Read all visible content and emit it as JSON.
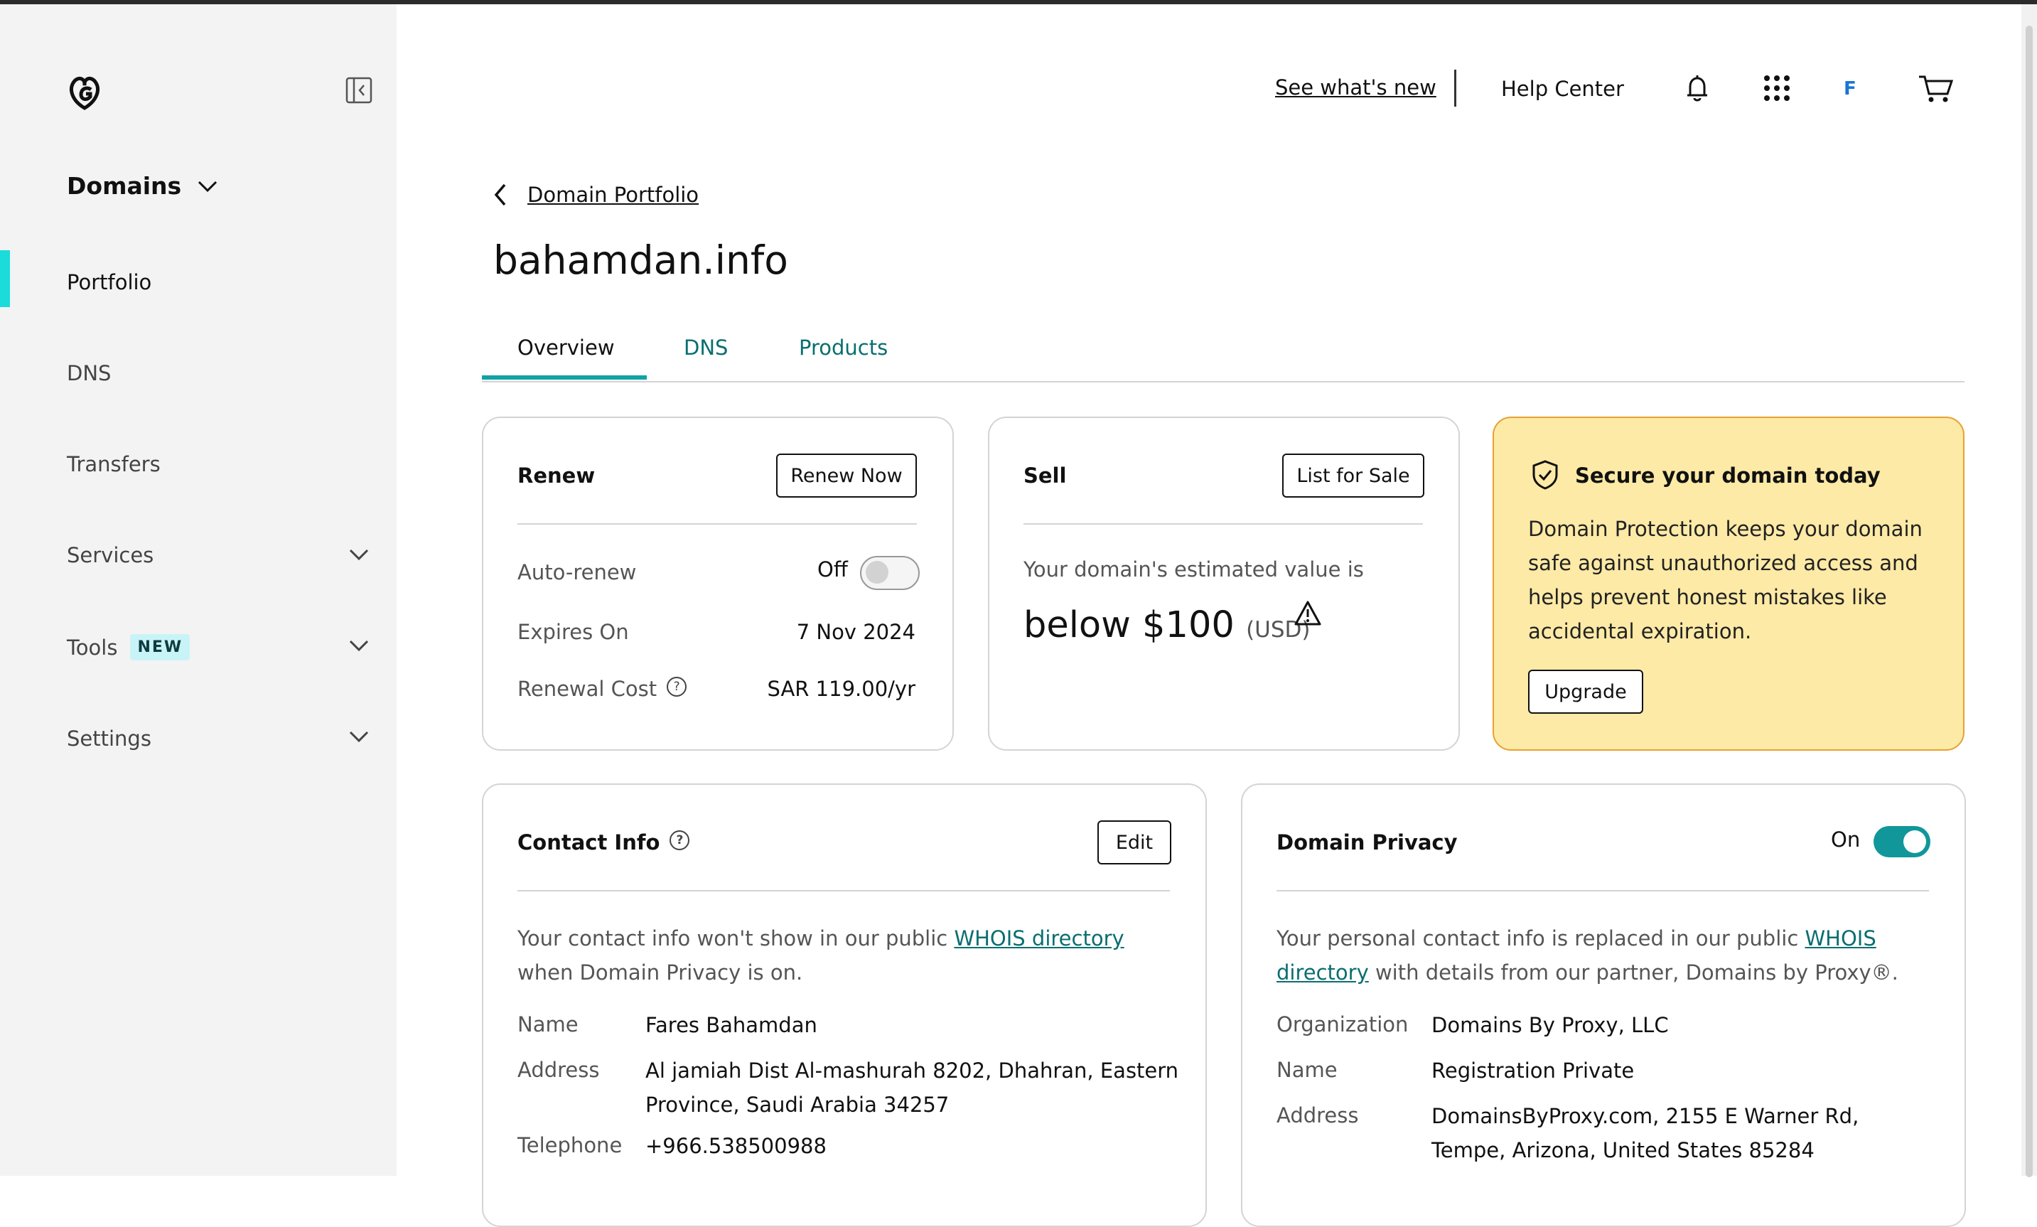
{
  "sidebar": {
    "section_title": "Domains",
    "items": [
      {
        "label": "Portfolio"
      },
      {
        "label": "DNS"
      },
      {
        "label": "Transfers"
      },
      {
        "label": "Services"
      },
      {
        "label": "Tools",
        "badge": "NEW"
      },
      {
        "label": "Settings"
      }
    ]
  },
  "header": {
    "whats_new": "See what's new",
    "help_center": "Help Center",
    "avatar_initial": "F"
  },
  "breadcrumb": {
    "back_label": "Domain Portfolio"
  },
  "page": {
    "domain": "bahamdan.info"
  },
  "tabs": [
    {
      "label": "Overview",
      "active": true
    },
    {
      "label": "DNS"
    },
    {
      "label": "Products"
    }
  ],
  "renew": {
    "title": "Renew",
    "button": "Renew Now",
    "auto_renew_label": "Auto-renew",
    "auto_renew_state": "Off",
    "expires_label": "Expires On",
    "expires_value": "7 Nov 2024",
    "cost_label": "Renewal Cost",
    "cost_value": "SAR 119.00/yr"
  },
  "sell": {
    "title": "Sell",
    "button": "List for Sale",
    "estimate_text": "Your domain's estimated value is",
    "value": "below $100",
    "currency": "(USD)"
  },
  "promo": {
    "title": "Secure your domain today",
    "body": "Domain Protection keeps your domain safe against unauthorized access and helps prevent honest mistakes like accidental expiration.",
    "button": "Upgrade"
  },
  "contact": {
    "title": "Contact Info",
    "button": "Edit",
    "desc_before": "Your contact info won't show in our public ",
    "desc_link": "WHOIS directory",
    "desc_after": " when Domain Privacy is on.",
    "name_label": "Name",
    "name_value": "Fares Bahamdan",
    "address_label": "Address",
    "address_line1": "Al jamiah Dist Al-mashurah 8202, Dhahran, Eastern",
    "address_line2": "Province, Saudi Arabia 34257",
    "phone_label": "Telephone",
    "phone_value": "+966.538500988"
  },
  "privacy": {
    "title": "Domain Privacy",
    "state": "On",
    "desc_before": "Your personal contact info is replaced in our public ",
    "desc_link1": "WHOIS",
    "desc_link2": "directory",
    "desc_after": " with details from our partner, Domains by Proxy®.",
    "org_label": "Organization",
    "org_value": "Domains By Proxy, LLC",
    "name_label": "Name",
    "name_value": "Registration Private",
    "address_label": "Address",
    "address_line1": "DomainsByProxy.com, 2155 E Warner Rd,",
    "address_line2": "Tempe, Arizona, United States 85284"
  },
  "colors": {
    "accent": "#12a2a4",
    "link": "#0a6e70",
    "active_bar": "#1bdbdb",
    "promo_bg": "#fdeaa6",
    "promo_border": "#e7a132",
    "toggle_on": "#11979a"
  },
  "icons": [
    "logo-icon",
    "sidebar-collapse-icon",
    "chevron-down-icon",
    "chevron-left-icon",
    "bell-icon",
    "apps-grid-icon",
    "cart-icon",
    "help-icon",
    "warning-icon",
    "shield-check-icon"
  ]
}
